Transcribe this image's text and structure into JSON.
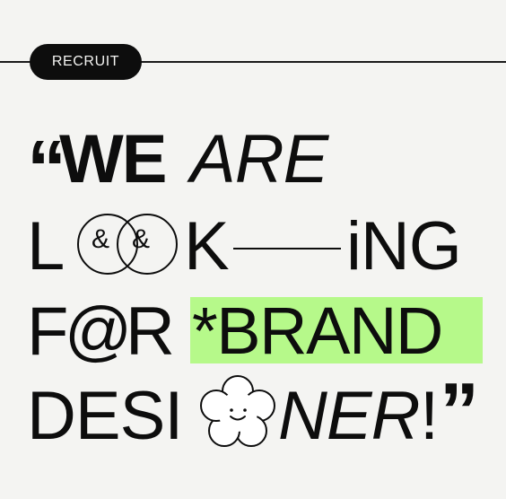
{
  "badge": {
    "label": "RECRUIT"
  },
  "headline": {
    "quote_open": "“",
    "line1": {
      "bold": "WE",
      "italic": "ARE"
    },
    "line2": {
      "l": "L",
      "ring_text_1": "&",
      "ring_text_2": "&",
      "k": "K",
      "dash": "——",
      "ing": "iNG"
    },
    "line3": {
      "f": "F",
      "at": "@",
      "r": "R",
      "highlight": "*BRAND"
    },
    "line4": {
      "desi": "DESI",
      "ner": "NER",
      "bang": "!",
      "quote_close": "”"
    }
  },
  "colors": {
    "background": "#f4f4f2",
    "ink": "#0d0d0d",
    "highlight": "#b6f98a"
  }
}
